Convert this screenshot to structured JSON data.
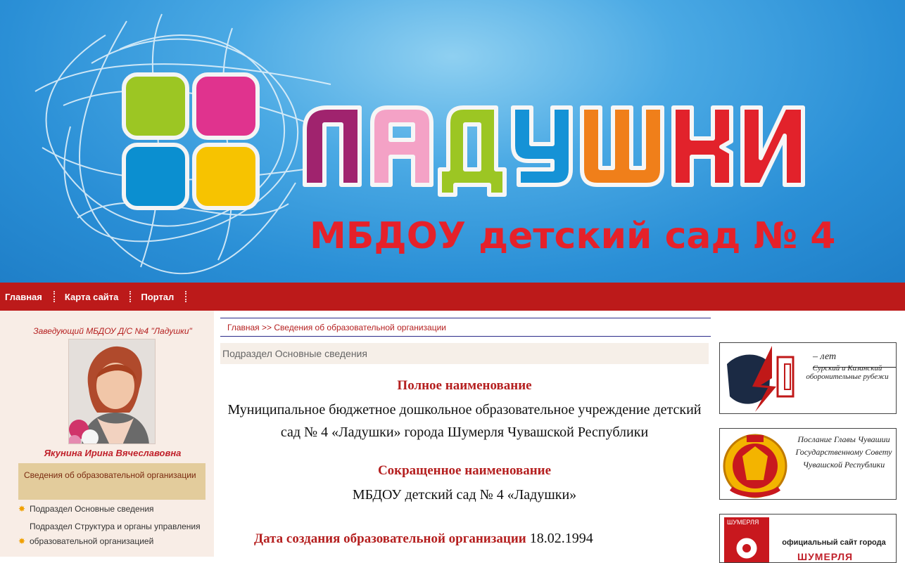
{
  "banner": {
    "logo_text": "ЛАДУШКИ",
    "subtitle": "МБДОУ детский сад № 4",
    "colors": {
      "square_green": "#9cc623",
      "square_pink": "#e0338e",
      "square_blue": "#0b8fd0",
      "square_yellow": "#f7c300",
      "letter_purple": "#a0236e",
      "letter_pink": "#f4a2c6",
      "letter_green": "#9cc623",
      "letter_blue": "#1592d6",
      "letter_orange": "#f07f1a",
      "letter_red": "#e2222b"
    }
  },
  "topmenu": {
    "items": [
      {
        "label": "Главная"
      },
      {
        "label": "Карта сайта"
      },
      {
        "label": "Портал"
      }
    ]
  },
  "sidebar": {
    "head_caption": "Заведующий МБДОУ Д/С №4 \"Ладушки\"",
    "head_name": "Якунина Ирина Вячеславовна",
    "active_item": "Сведения об образовательной организации",
    "items": [
      {
        "label": "Подраздел Основные сведения"
      },
      {
        "label": "Подраздел Структура и органы управления образовательной организацией"
      }
    ]
  },
  "breadcrumb": {
    "home": "Главная",
    "separator": " >> ",
    "current": "Сведения об образовательной организации"
  },
  "main": {
    "subsection": "Подраздел Основные сведения",
    "full_name_heading": "Полное наименование",
    "full_name": "Муниципальное бюджетное дошкольное образовательное учреждение детский сад № 4 «Ладушки» города Шумерля Чувашской Республики",
    "short_name_heading": "Сокращенное наименование",
    "short_name": "МБДОУ детский сад № 4 «Ладушки»",
    "founded_label": "Дата создания образовательной организации",
    "founded_value": " 18.02.1994"
  },
  "right_banners": {
    "b1_years": "– лет",
    "b1_text": "Сурский и Казанский оборонительные рубежи",
    "b2_text": "Послание Главы Чувашии Государственному Совету Чувашской Республики",
    "b3_badge": "ШУМЕРЛЯ",
    "b3_text": "официальный сайт города",
    "b3_city": "ШУМЕРЛЯ"
  }
}
